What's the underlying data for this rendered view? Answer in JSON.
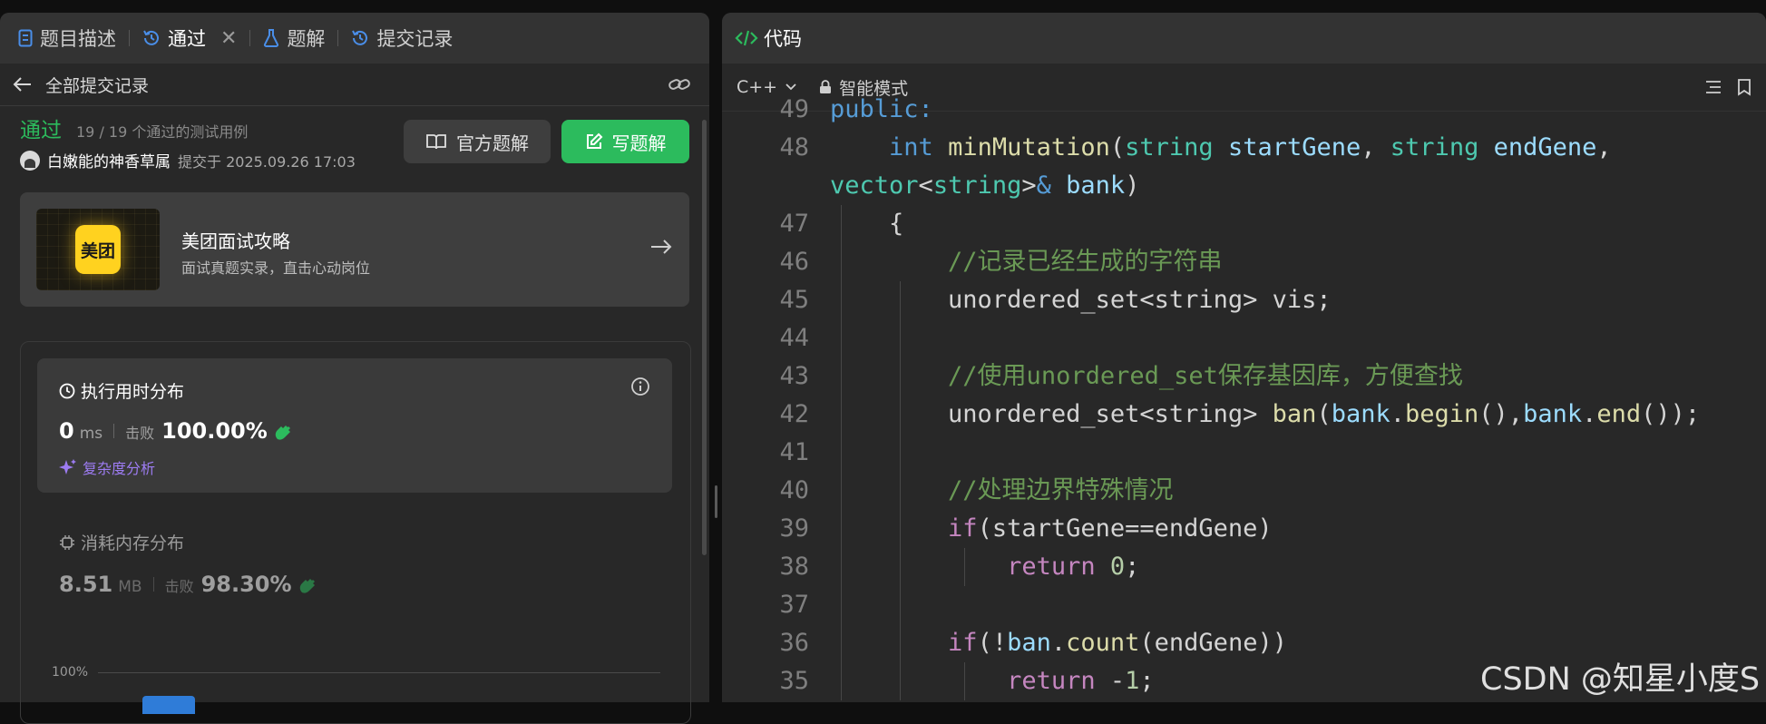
{
  "left_tabs": {
    "description": "题目描述",
    "accepted": "通过",
    "close": "✕",
    "solutions": "题解",
    "submissions": "提交记录"
  },
  "submission_header": {
    "back_label": "全部提交记录"
  },
  "submission": {
    "status": "通过",
    "cases": "19 / 19 个通过的测试用例",
    "user": "白嫩能的神香草属",
    "submitted_at": "提交于 2025.09.26 17:03",
    "official_solution_label": "官方题解",
    "write_solution_label": "写题解"
  },
  "promo": {
    "logo_text": "美团",
    "title": "美团面试攻略",
    "subtitle": "面试真题实录，直击心动岗位"
  },
  "runtime": {
    "title": "执行用时分布",
    "value": "0",
    "unit": "ms",
    "beat_label": "击败",
    "beat": "100.00%",
    "analysis_label": "复杂度分析"
  },
  "memory": {
    "title": "消耗内存分布",
    "value": "8.51",
    "unit": "MB",
    "beat_label": "击败",
    "beat": "98.30%"
  },
  "histogram": {
    "axis_top_label": "100%"
  },
  "code_panel": {
    "title": "代码",
    "language": "C++",
    "mode": "智能模式"
  },
  "code_lines": [
    {
      "ln": "49",
      "tokens": [
        [
          "kw",
          "public:"
        ]
      ]
    },
    {
      "ln": "48",
      "tokens": [
        [
          "",
          "    "
        ],
        [
          "kw",
          "int"
        ],
        [
          "",
          " "
        ],
        [
          "fn",
          "minMutation"
        ],
        [
          "",
          "("
        ],
        [
          "ty",
          "string"
        ],
        [
          "",
          " "
        ],
        [
          "vr",
          "startGene"
        ],
        [
          "",
          ", "
        ],
        [
          "ty",
          "string"
        ],
        [
          "",
          " "
        ],
        [
          "vr",
          "endGene"
        ],
        [
          "",
          ","
        ]
      ]
    },
    {
      "ln": "",
      "tokens": [
        [
          "ty",
          "vector"
        ],
        [
          "",
          "<"
        ],
        [
          "ty",
          "string"
        ],
        [
          "",
          ">"
        ],
        [
          "kw",
          "&"
        ],
        [
          "",
          " "
        ],
        [
          "vr",
          "bank"
        ],
        [
          "",
          ")"
        ]
      ]
    },
    {
      "ln": "47",
      "tokens": [
        [
          "",
          "    {"
        ]
      ]
    },
    {
      "ln": "46",
      "tokens": [
        [
          "",
          "        "
        ],
        [
          "cm",
          "//记录已经生成的字符串"
        ]
      ]
    },
    {
      "ln": "45",
      "tokens": [
        [
          "",
          "        unordered_set<string> vis;"
        ]
      ]
    },
    {
      "ln": "44",
      "tokens": []
    },
    {
      "ln": "43",
      "tokens": [
        [
          "",
          "        "
        ],
        [
          "cm",
          "//使用unordered_set保存基因库，方便查找"
        ]
      ]
    },
    {
      "ln": "42",
      "tokens": [
        [
          "",
          "        unordered_set<string> "
        ],
        [
          "fn",
          "ban"
        ],
        [
          "",
          "("
        ],
        [
          "vr",
          "bank"
        ],
        [
          "",
          "."
        ],
        [
          "fn",
          "begin"
        ],
        [
          "",
          "(),"
        ],
        [
          "vr",
          "bank"
        ],
        [
          "",
          "."
        ],
        [
          "fn",
          "end"
        ],
        [
          "",
          "());"
        ]
      ]
    },
    {
      "ln": "41",
      "tokens": []
    },
    {
      "ln": "40",
      "tokens": [
        [
          "",
          "        "
        ],
        [
          "cm",
          "//处理边界特殊情况"
        ]
      ]
    },
    {
      "ln": "39",
      "tokens": [
        [
          "",
          "        "
        ],
        [
          "ctl",
          "if"
        ],
        [
          "",
          "(startGene==endGene)"
        ]
      ]
    },
    {
      "ln": "38",
      "tokens": [
        [
          "",
          "            "
        ],
        [
          "ctl",
          "return"
        ],
        [
          "",
          " "
        ],
        [
          "num",
          "0"
        ],
        [
          "",
          ";"
        ]
      ]
    },
    {
      "ln": "37",
      "tokens": []
    },
    {
      "ln": "36",
      "tokens": [
        [
          "",
          "        "
        ],
        [
          "ctl",
          "if"
        ],
        [
          "",
          "(!"
        ],
        [
          "vr",
          "ban"
        ],
        [
          "",
          "."
        ],
        [
          "fn",
          "count"
        ],
        [
          "",
          "(endGene))"
        ]
      ]
    },
    {
      "ln": "35",
      "tokens": [
        [
          "",
          "            "
        ],
        [
          "ctl",
          "return"
        ],
        [
          "",
          " -"
        ],
        [
          "num",
          "1"
        ],
        [
          "",
          ";"
        ]
      ]
    }
  ],
  "watermark": "CSDN @知星小度S"
}
